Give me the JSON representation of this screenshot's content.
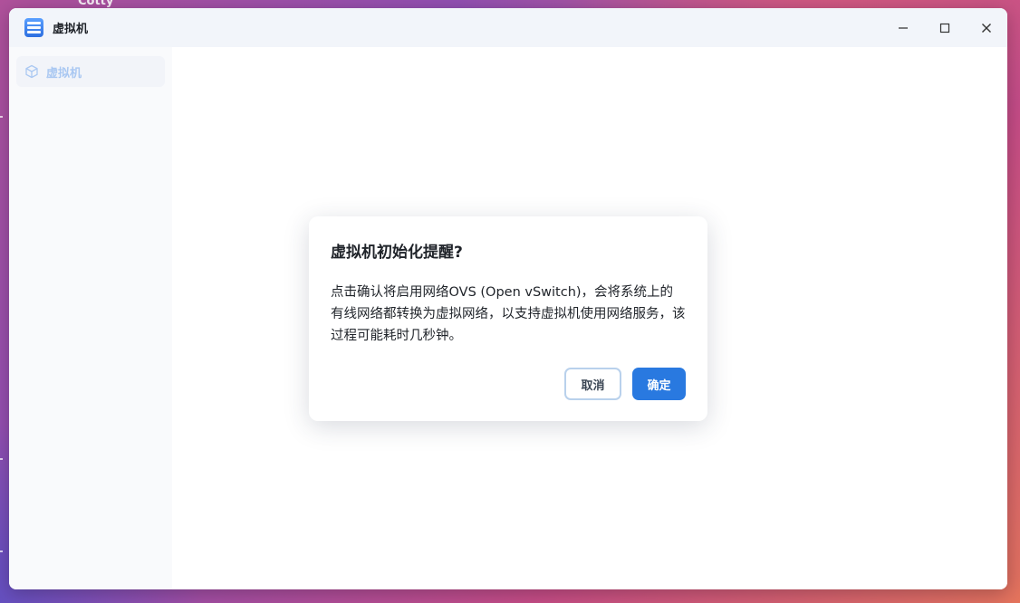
{
  "desktop": {
    "partial_label": "Cotty"
  },
  "window": {
    "title": "虚拟机",
    "controls": {
      "minimize": "minimize-icon",
      "maximize": "maximize-icon",
      "close": "close-icon"
    }
  },
  "sidebar": {
    "items": [
      {
        "label": "虚拟机",
        "icon": "cube-icon"
      }
    ]
  },
  "dialog": {
    "title": "虚拟机初始化提醒?",
    "message": "点击确认将启用网络OVS (Open vSwitch)，会将系统上的有线网络都转换为虚拟网络，以支持虚拟机使用网络服务，该过程可能耗时几秒钟。",
    "cancel_label": "取消",
    "confirm_label": "确定"
  },
  "colors": {
    "accent": "#2979e0",
    "sidebar_label": "#aac8f2",
    "titlebar_bg": "#f2f5fa"
  }
}
